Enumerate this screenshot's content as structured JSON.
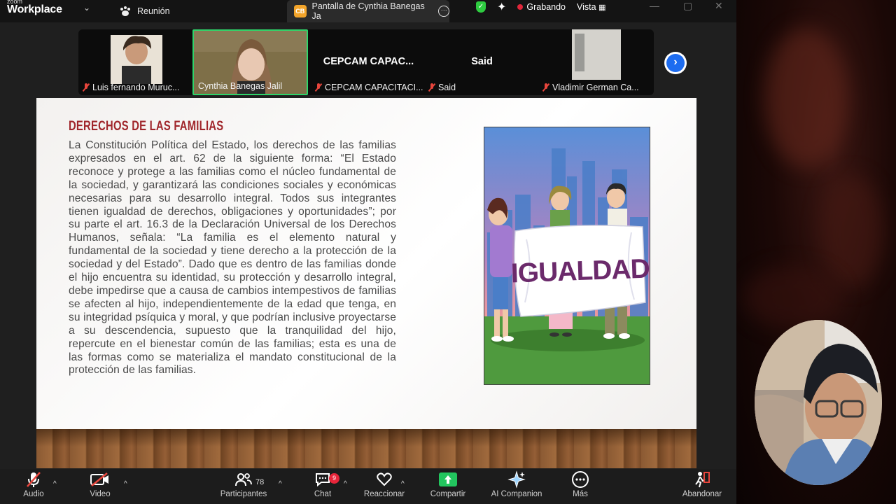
{
  "top_bar": {
    "logo_small": "zoom",
    "logo_big": "Workplace",
    "meeting_tab": "Reunión",
    "share_badge": "CB",
    "share_tab": "Pantalla de Cynthia Banegas Ja",
    "recording": "Grabando",
    "view": "Vista"
  },
  "participants": [
    {
      "name": "Luis fernando Muruc...",
      "muted": true,
      "video": true
    },
    {
      "name": "Cynthia Banegas Jalil",
      "muted": false,
      "video": true,
      "active_speaker": true
    },
    {
      "name": "CEPCAM CAPACITACI...",
      "display": "CEPCAM  CAPAC...",
      "muted": true,
      "video": false
    },
    {
      "name": "Said",
      "display": "Said",
      "muted": true,
      "video": false
    },
    {
      "name": "Vladimir German Ca...",
      "muted": true,
      "video": true
    }
  ],
  "slide": {
    "title": "DERECHOS DE LAS FAMILIAS",
    "body": "La Constitución Política del Estado, los derechos de las familias expresados en el art. 62 de la siguiente forma: “El Estado reconoce y protege a las familias como el núcleo fundamental de la sociedad, y garantizará las condiciones sociales y económicas necesarias para su desarrollo integral. Todos sus integrantes tienen igualdad de derechos, obligaciones y oportunidades”; por su parte el art. 16.3 de la Declaración Universal de los Derechos Humanos, señala: “La familia es el elemento natural y fundamental de la sociedad y tiene derecho a la protección de la sociedad y del Estado”. Dado que es dentro de las familias donde el hijo encuentra su identidad, su protección y desarrollo integral, debe impedirse que a causa de cambios intempestivos de familias se afecten al hijo, independientemente de la edad que tenga, en su integridad psíquica y moral, y que podrían inclusive proyectarse a su descendencia, supuesto que la tranquilidad del hijo, repercute en el bienestar común de las familias; esta es una de las formas como se materializa el mandato constitucional de la protección de las familias.",
    "banner_text": "IGUALDAD"
  },
  "toolbar": {
    "audio": "Audio",
    "video": "Video",
    "participants": "Participantes",
    "participants_count": "78",
    "chat": "Chat",
    "chat_badge": "9",
    "react": "Reaccionar",
    "share": "Compartir",
    "ai": "AI Companion",
    "more": "Más",
    "leave": "Abandonar"
  },
  "colors": {
    "active_speaker_border": "#2fd46a",
    "recording": "#e0263a",
    "share_button": "#22c55e",
    "slide_title": "#a0262b",
    "next_button": "#1d6cf0"
  }
}
